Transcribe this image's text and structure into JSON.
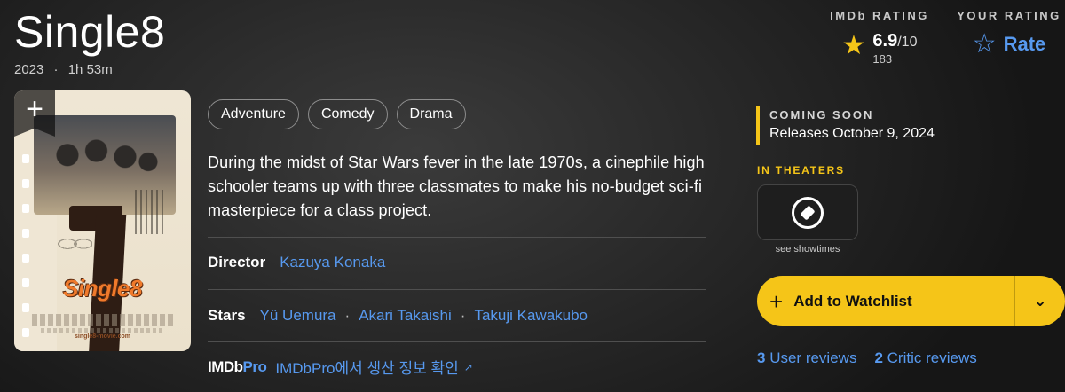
{
  "title": "Single8",
  "meta": {
    "year": "2023",
    "separator": "·",
    "runtime": "1h 53m"
  },
  "imdb_rating": {
    "label": "IMDb RATING",
    "score": "6.9",
    "max": "/10",
    "votes": "183"
  },
  "your_rating": {
    "label": "YOUR RATING",
    "action": "Rate"
  },
  "poster": {
    "title_text": "Single8",
    "url_text": "single8-movie.com",
    "add_symbol": "+"
  },
  "genres": [
    "Adventure",
    "Comedy",
    "Drama"
  ],
  "plot": "During the midst of Star Wars fever in the late 1970s, a cinephile high schooler teams up with three classmates to make his no-budget sci-fi masterpiece for a class project.",
  "director": {
    "label": "Director",
    "name": "Kazuya Konaka"
  },
  "stars": {
    "label": "Stars",
    "names": [
      "Yû Uemura",
      "Akari Takaishi",
      "Takuji Kawakubo"
    ],
    "separator": "·"
  },
  "imdbpro": {
    "logo_main": "IMDb",
    "logo_pro": "Pro",
    "link": "IMDbPro에서 생산 정보 확인"
  },
  "release": {
    "status": "COMING SOON",
    "text": "Releases October 9, 2024"
  },
  "theaters": {
    "label": "IN THEATERS",
    "button_label": "see showtimes"
  },
  "watchlist": {
    "plus": "+",
    "label": "Add to Watchlist"
  },
  "reviews": {
    "user_count": "3",
    "user_label": "User reviews",
    "critic_count": "2",
    "critic_label": "Critic reviews"
  },
  "colors": {
    "accent": "#f5c518",
    "link": "#5799ef",
    "background": "#2a2a2a"
  }
}
